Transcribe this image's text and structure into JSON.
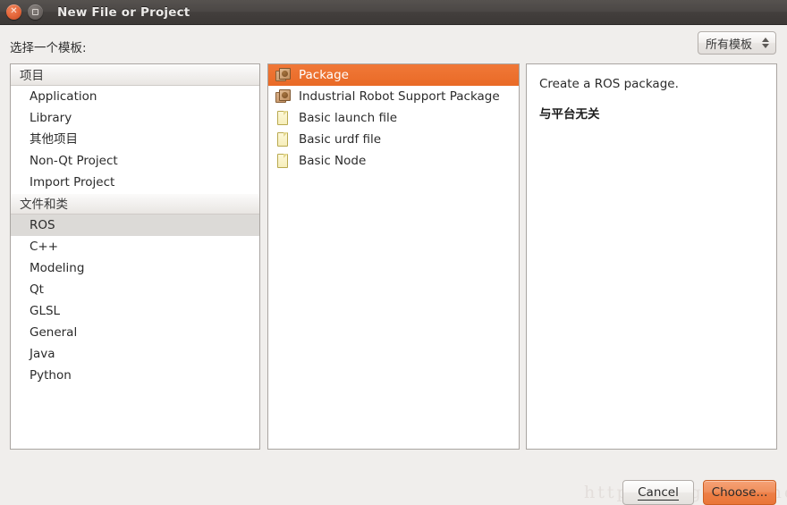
{
  "window": {
    "title": "New File or Project",
    "close_icon": "close-icon",
    "maximize_icon": "maximize-icon"
  },
  "top": {
    "prompt": "选择一个模板:",
    "filter_value": "所有模板",
    "spinner_icon": "up-down-arrows-icon"
  },
  "categories": [
    {
      "type": "header",
      "label": "项目"
    },
    {
      "type": "item",
      "label": "Application",
      "selected": false
    },
    {
      "type": "item",
      "label": "Library",
      "selected": false
    },
    {
      "type": "item",
      "label": "其他项目",
      "selected": false
    },
    {
      "type": "item",
      "label": "Non-Qt Project",
      "selected": false
    },
    {
      "type": "item",
      "label": "Import Project",
      "selected": false
    },
    {
      "type": "header",
      "label": "文件和类"
    },
    {
      "type": "item",
      "label": "ROS",
      "selected": true
    },
    {
      "type": "item",
      "label": "C++",
      "selected": false
    },
    {
      "type": "item",
      "label": "Modeling",
      "selected": false
    },
    {
      "type": "item",
      "label": "Qt",
      "selected": false
    },
    {
      "type": "item",
      "label": "GLSL",
      "selected": false
    },
    {
      "type": "item",
      "label": "General",
      "selected": false
    },
    {
      "type": "item",
      "label": "Java",
      "selected": false
    },
    {
      "type": "item",
      "label": "Python",
      "selected": false
    }
  ],
  "templates": [
    {
      "label": "Package",
      "icon": "package-icon",
      "selected": true
    },
    {
      "label": "Industrial Robot Support Package",
      "icon": "package-icon",
      "selected": false
    },
    {
      "label": "Basic launch file",
      "icon": "document-icon",
      "selected": false
    },
    {
      "label": "Basic urdf file",
      "icon": "document-icon",
      "selected": false
    },
    {
      "label": "Basic Node",
      "icon": "document-icon",
      "selected": false
    }
  ],
  "description": {
    "summary": "Create a ROS package.",
    "platform": "与平台无关"
  },
  "footer": {
    "watermark": "http://blog.csdn.net/",
    "cancel_label": "Cancel",
    "choose_label": "Choose..."
  },
  "colors": {
    "accent_orange": "#ed7a38",
    "selection_gray": "#dcdad7",
    "dialog_bg": "#f0eeec",
    "titlebar_dark": "#4b4745"
  }
}
